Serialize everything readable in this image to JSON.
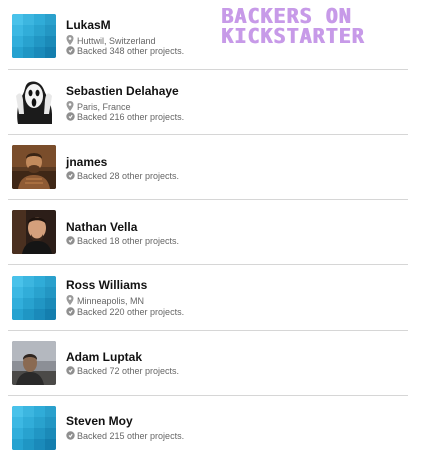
{
  "title": {
    "line1": "Backers on",
    "line2": "Kickstarter"
  },
  "backers": [
    {
      "name": "LukasM",
      "location": "Huttwil, Switzerland",
      "backed": "Backed 348 other projects.",
      "avatar": "default-avatar"
    },
    {
      "name": "Sebastien Delahaye",
      "location": "Paris, France",
      "backed": "Backed 216 other projects.",
      "avatar": "scream-avatar"
    },
    {
      "name": "jnames",
      "location": "",
      "backed": "Backed 28 other projects.",
      "avatar": "photo-avatar"
    },
    {
      "name": "Nathan Vella",
      "location": "",
      "backed": "Backed 18 other projects.",
      "avatar": "photo-avatar"
    },
    {
      "name": "Ross Williams",
      "location": "Minneapolis, MN",
      "backed": "Backed 220 other projects.",
      "avatar": "default-avatar"
    },
    {
      "name": "Adam Luptak",
      "location": "",
      "backed": "Backed 72 other projects.",
      "avatar": "photo-avatar"
    },
    {
      "name": "Steven Moy",
      "location": "",
      "backed": "Backed 215 other projects.",
      "avatar": "default-avatar"
    }
  ]
}
